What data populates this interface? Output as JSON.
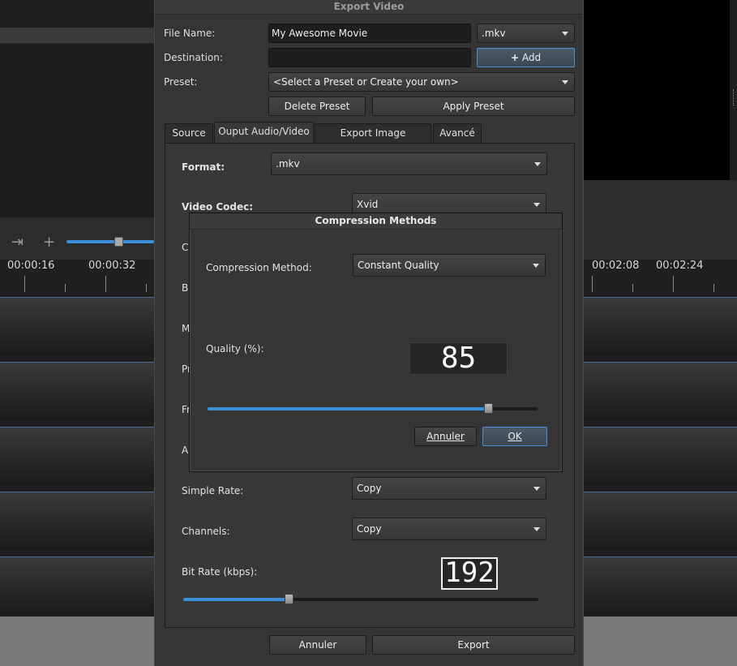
{
  "background": {
    "ruler_labels": [
      "00:00:16",
      "00:00:32",
      "00:02:08",
      "00:02:24"
    ]
  },
  "dialog": {
    "title": "Export Video",
    "file_name_label": "File Name:",
    "file_name_value": "My Awesome Movie",
    "extension_value": ".mkv",
    "destination_label": "Destination:",
    "destination_value": "",
    "add_label": "Add",
    "preset_label": "Preset:",
    "preset_value": "<Select a Preset or Create your own>",
    "delete_preset_label": "Delete Preset",
    "apply_preset_label": "Apply Preset",
    "tabs": [
      "Source",
      "Ouput Audio/Video",
      "Export Image Sequence",
      "Avancé"
    ],
    "active_tab": "Ouput Audio/Video",
    "format_label": "Format:",
    "format_value": ".mkv",
    "video_codec_label": "Video Codec:",
    "video_codec_value": "Xvid",
    "partial_labels": [
      "Co",
      "Bi",
      "M",
      "Pr",
      "Fr",
      "Au"
    ],
    "simple_rate_label": "Simple Rate:",
    "simple_rate_value": "Copy",
    "channels_label": "Channels:",
    "channels_value": "Copy",
    "bitrate_label": "Bit Rate (kbps):",
    "bitrate_value": "192",
    "bitrate_slider_fraction": 0.296,
    "cancel_label": "Annuler",
    "export_label": "Export"
  },
  "compression": {
    "title": "Compression Methods",
    "method_label": "Compression Method:",
    "method_value": "Constant Quality",
    "quality_label": "Quality (%):",
    "quality_value": "85",
    "quality_fraction": 0.85,
    "cancel_label": "Annuler",
    "ok_label": "OK"
  }
}
